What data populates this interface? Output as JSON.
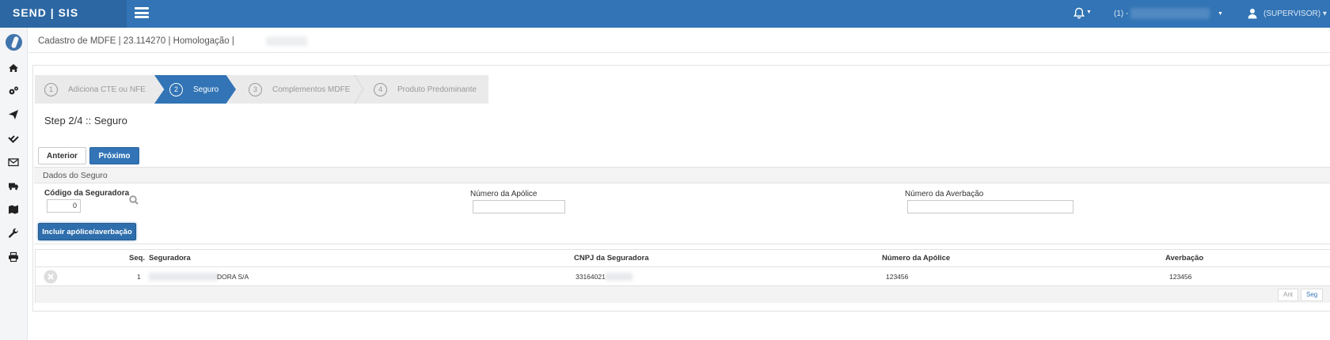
{
  "topbar": {
    "brand": "SEND | SIS",
    "company_prefix": "(1) -",
    "user": "(SUPERVISOR)"
  },
  "page": {
    "title": "Cadastro de MDFE | 23.114270 | Homologação |"
  },
  "wizard": {
    "steps": [
      {
        "num": "1",
        "label": "Adiciona CTE ou NFE",
        "active": false
      },
      {
        "num": "2",
        "label": "Seguro",
        "active": true
      },
      {
        "num": "3",
        "label": "Complementos MDFE",
        "active": false
      },
      {
        "num": "4",
        "label": "Produto Predominante",
        "active": false
      }
    ],
    "heading": "Step 2/4 :: Seguro",
    "prev_label": "Anterior",
    "next_label": "Próximo"
  },
  "seguro": {
    "section_title": "Dados do Seguro",
    "codigo_label": "Código da Seguradora",
    "codigo_value": "0",
    "apolice_label": "Número da Apólice",
    "apolice_value": "",
    "averbacao_label": "Número da Averbação",
    "averbacao_value": "",
    "include_label": "Incluir apólice/averbação"
  },
  "table": {
    "columns": [
      "Seq.",
      "Seguradora",
      "CNPJ da Seguradora",
      "Número da Apólice",
      "Averbação"
    ],
    "rows": [
      {
        "seq": "1",
        "seguradora": "DORA S/A",
        "cnpj": "33164021",
        "apolice": "123456",
        "averbacao": "123456"
      }
    ],
    "pager_prev": "Ant",
    "pager_next": "Seg"
  },
  "sidebar": {
    "icons": [
      "home-icon",
      "gears-icon",
      "send-icon",
      "check-double-icon",
      "envelope-icon",
      "truck-icon",
      "map-icon",
      "wrench-icon",
      "print-icon"
    ]
  },
  "colors": {
    "primary": "#3274b5",
    "brand_bg": "#2c67a3",
    "wizard_bg": "#eaeaea"
  }
}
